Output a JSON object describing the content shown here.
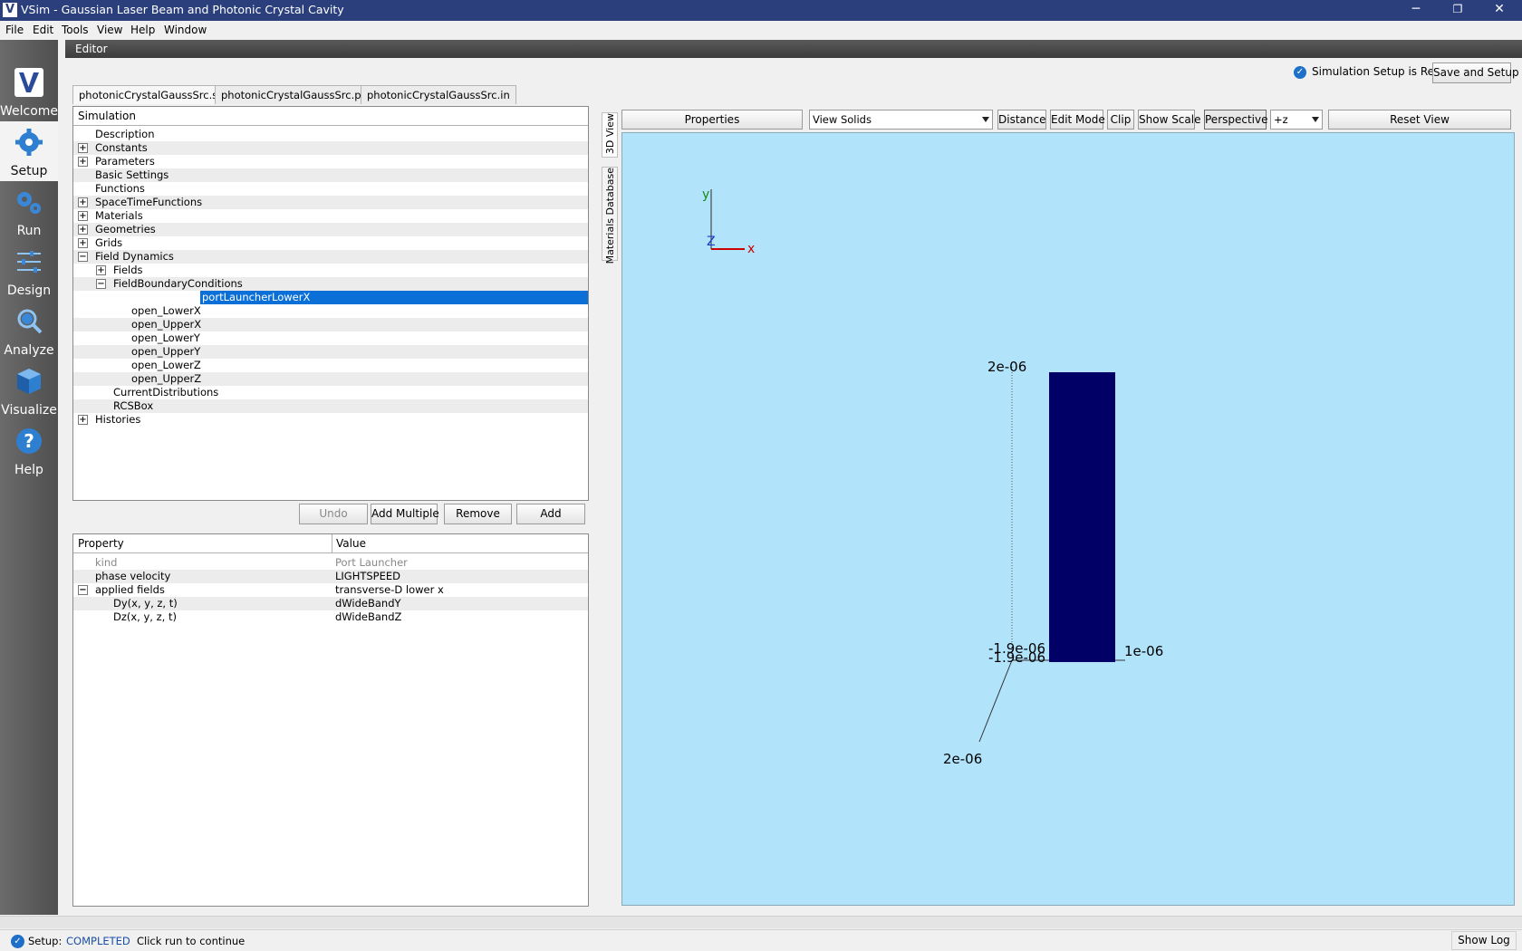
{
  "window": {
    "title": "VSim - Gaussian Laser Beam and Photonic Crystal Cavity",
    "min": "─",
    "max": "❐",
    "close": "✕"
  },
  "menu": [
    "File",
    "Edit",
    "Tools",
    "View",
    "Help",
    "Window"
  ],
  "nav": [
    {
      "label": "Welcome",
      "icon": "vsim-logo-icon"
    },
    {
      "label": "Setup",
      "icon": "gear-icon"
    },
    {
      "label": "Run",
      "icon": "gears-icon"
    },
    {
      "label": "Design",
      "icon": "sliders-icon"
    },
    {
      "label": "Analyze",
      "icon": "magnifier-icon"
    },
    {
      "label": "Visualize",
      "icon": "cube-icon"
    },
    {
      "label": "Help",
      "icon": "question-icon"
    }
  ],
  "editor": {
    "header": "Editor",
    "status": "Simulation Setup is Ready",
    "save_button": "Save and Setup"
  },
  "tabs": [
    "photonicCrystalGaussSrc.sdf",
    "photonicCrystalGaussSrc.pre",
    "photonicCrystalGaussSrc.in"
  ],
  "tree": {
    "header": "Simulation",
    "items": [
      "Description",
      "Constants",
      "Parameters",
      "Basic Settings",
      "Functions",
      "SpaceTimeFunctions",
      "Materials",
      "Geometries",
      "Grids",
      "Field Dynamics",
      "Fields",
      "FieldBoundaryConditions",
      "portLauncherLowerX",
      "open_LowerX",
      "open_UpperX",
      "open_LowerY",
      "open_UpperY",
      "open_LowerZ",
      "open_UpperZ",
      "CurrentDistributions",
      "RCSBox",
      "Histories"
    ]
  },
  "tree_buttons": {
    "undo": "Undo",
    "add_multiple": "Add Multiple",
    "remove": "Remove",
    "add": "Add"
  },
  "properties": {
    "col_property": "Property",
    "col_value": "Value",
    "rows": [
      {
        "k": "kind",
        "v": "Port Launcher"
      },
      {
        "k": "phase velocity",
        "v": "LIGHTSPEED"
      },
      {
        "k": "applied fields",
        "v": "transverse-D lower x"
      },
      {
        "k": "Dy(x, y, z, t)",
        "v": "dWideBandY"
      },
      {
        "k": "Dz(x, y, z, t)",
        "v": "dWideBandZ"
      }
    ]
  },
  "side_tabs": {
    "view3d": "3D View",
    "materials": "Materials Database"
  },
  "view_toolbar": {
    "properties": "Properties",
    "view_mode": "View Solids",
    "distance": "Distance",
    "edit_mode": "Edit Mode",
    "clip": "Clip",
    "show_scale": "Show Scale",
    "perspective": "Perspective",
    "axis": "+z",
    "reset_view": "Reset View"
  },
  "viewport": {
    "axis_y": "y",
    "axis_z": "Z",
    "axis_x": "x",
    "label_top": "2e-06",
    "label_mid1": "-1.9e-06",
    "label_mid2": "-1.9e-06",
    "label_right": "1e-06",
    "label_bottom": "2e-06",
    "solid_color": "#000066",
    "background": "#b1e4fb"
  },
  "statusbar": {
    "setup": "Setup:",
    "state": "COMPLETED",
    "hint": "Click run to continue",
    "show_log": "Show Log"
  }
}
